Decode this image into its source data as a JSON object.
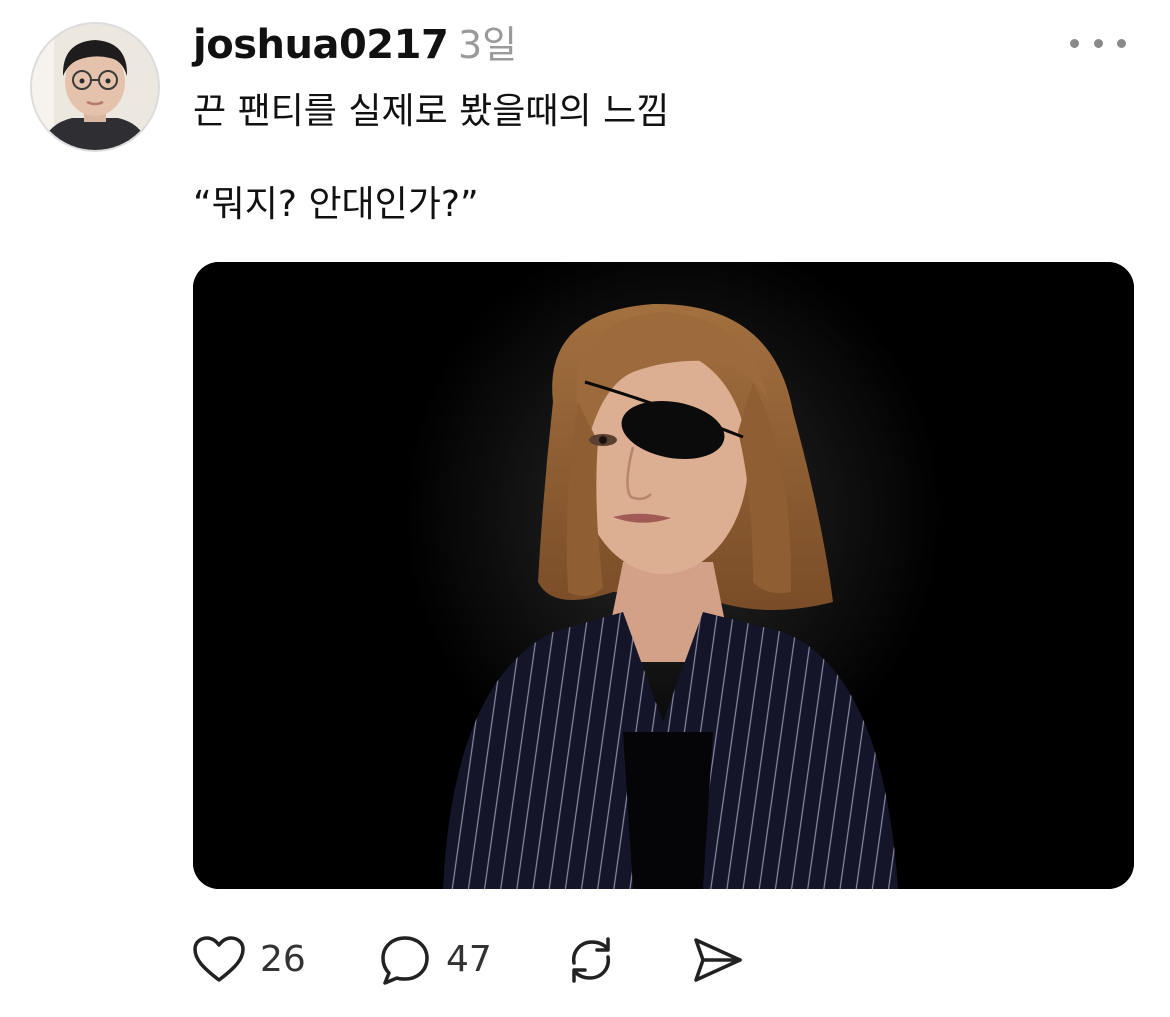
{
  "post": {
    "username": "joshua0217",
    "timestamp": "3일",
    "text_line1": "끈 팬티를 실제로 봤을때의 느낌",
    "text_line2": "“뭐지? 안대인가?”"
  },
  "actions": {
    "likes": "26",
    "replies": "47"
  },
  "colors": {
    "text": "#111111",
    "muted": "#9a9a9a",
    "icon": "#222222",
    "media_bg": "#000000"
  },
  "icons": {
    "more": "more-horizontal-icon",
    "like": "heart-icon",
    "reply": "speech-bubble-icon",
    "repost": "repost-arrows-icon",
    "share": "paper-plane-icon"
  }
}
